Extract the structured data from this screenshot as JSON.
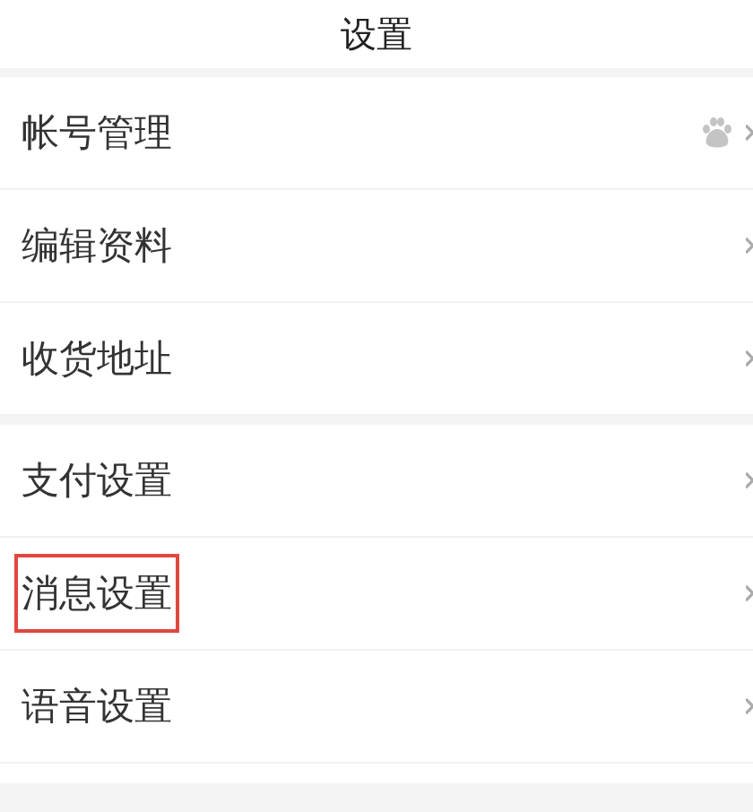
{
  "title": "设置",
  "groups": [
    {
      "items": [
        {
          "label": "帐号管理",
          "kind": "account"
        },
        {
          "label": "编辑资料",
          "kind": "plain"
        },
        {
          "label": "收货地址",
          "kind": "plain"
        }
      ]
    },
    {
      "items": [
        {
          "label": "支付设置",
          "kind": "plain"
        },
        {
          "label": "消息设置",
          "kind": "plain",
          "highlighted": true
        },
        {
          "label": "语音设置",
          "kind": "plain"
        }
      ]
    }
  ]
}
